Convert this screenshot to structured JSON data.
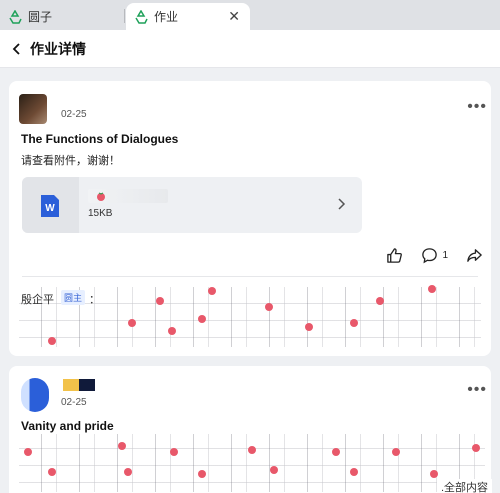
{
  "tabs": [
    {
      "label": "圆子",
      "icon": "recycle-icon"
    },
    {
      "label": "作业",
      "icon": "recycle-icon",
      "close": "✕"
    }
  ],
  "header": {
    "title": "作业详情",
    "back_icon": "chevron-left-icon"
  },
  "posts": [
    {
      "date": "02-25",
      "title": "The Functions of Dialogues",
      "body": "请查看附件，谢谢！",
      "attachment": {
        "type_icon": "word-file-icon",
        "size": "15KB"
      },
      "actions": {
        "like_icon": "thumbs-up-icon",
        "comment_icon": "comment-icon",
        "comment_count": "1",
        "share_icon": "share-icon"
      },
      "comment": {
        "author": "殷企平",
        "role": "圆主",
        "separator": "："
      }
    },
    {
      "date": "02-25",
      "title": "Vanity and pride"
    }
  ],
  "footer": {
    "link": ".全部内容"
  },
  "colors": {
    "accent": "#3a66d6",
    "word_blue": "#2b5fd9",
    "berry": "#e8586a"
  }
}
